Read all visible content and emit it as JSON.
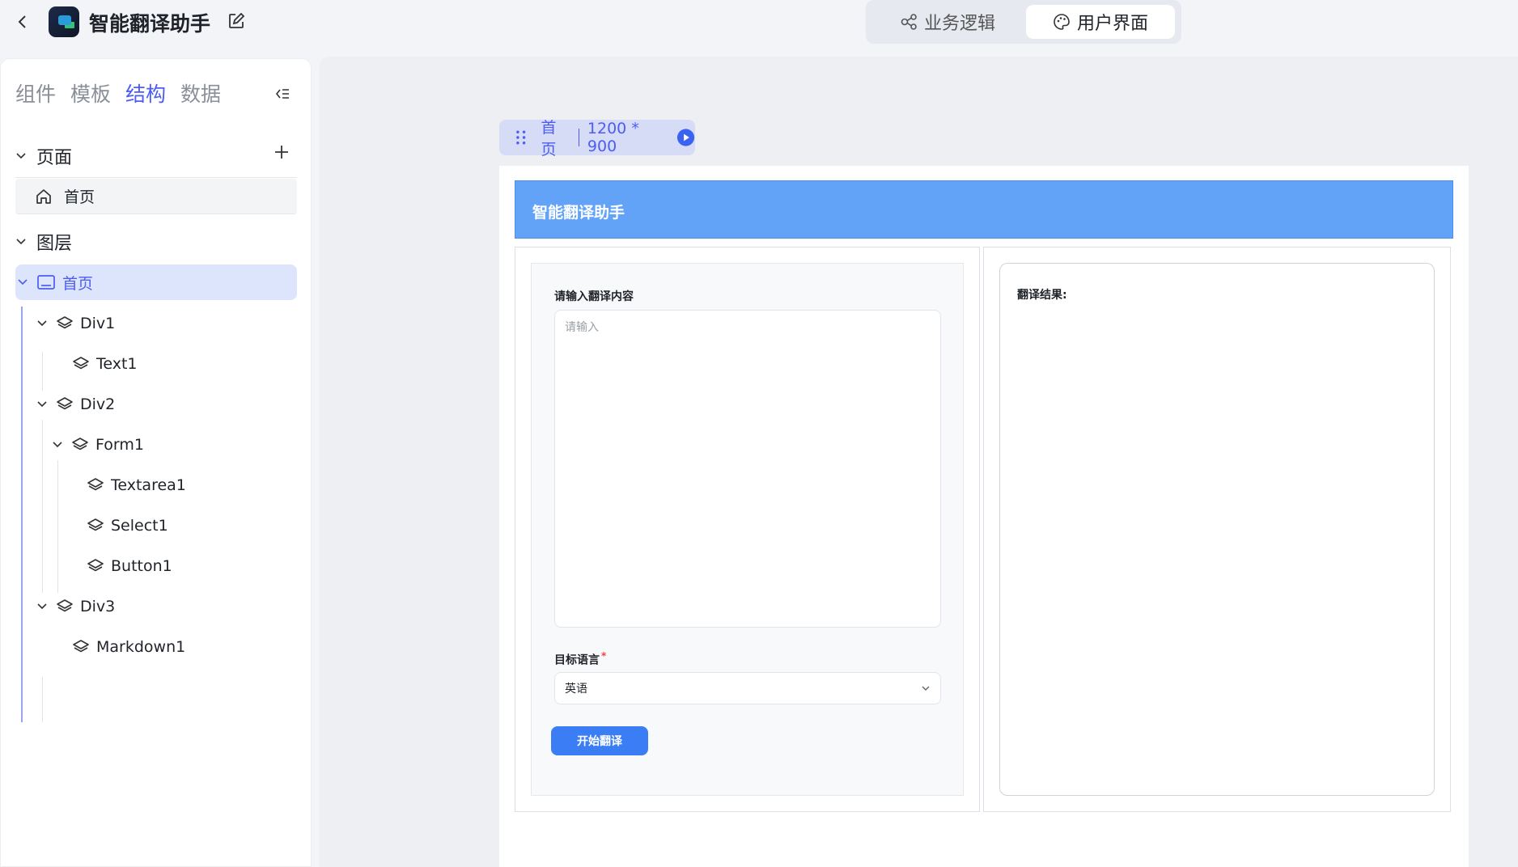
{
  "app": {
    "title": "智能翻译助手",
    "modes": [
      {
        "label": "业务逻辑",
        "active": false
      },
      {
        "label": "用户界面",
        "active": true
      }
    ]
  },
  "sidebar": {
    "tabs": [
      {
        "label": "组件",
        "active": false
      },
      {
        "label": "模板",
        "active": false
      },
      {
        "label": "结构",
        "active": true
      },
      {
        "label": "数据",
        "active": false
      }
    ],
    "pages_header": "页面",
    "pages": [
      {
        "label": "首页"
      }
    ],
    "layers_header": "图层",
    "layers": {
      "root": "首页",
      "div1": "Div1",
      "text1": "Text1",
      "div2": "Div2",
      "form1": "Form1",
      "textarea1": "Textarea1",
      "select1": "Select1",
      "button1": "Button1",
      "div3": "Div3",
      "markdown1": "Markdown1"
    }
  },
  "canvas": {
    "frame_name": "首页",
    "frame_size": "1200 * 900",
    "page": {
      "header_title": "智能翻译助手",
      "input_label": "请输入翻译内容",
      "input_placeholder": "请输入",
      "input_value": "",
      "target_label": "目标语言",
      "required_mark": "*",
      "target_value": "英语",
      "button_label": "开始翻译",
      "result_label": "翻译结果:"
    }
  },
  "colors": {
    "accent": "#4d5cf2",
    "header_bg": "#62a3f8",
    "button_bg": "#3b7df5"
  }
}
